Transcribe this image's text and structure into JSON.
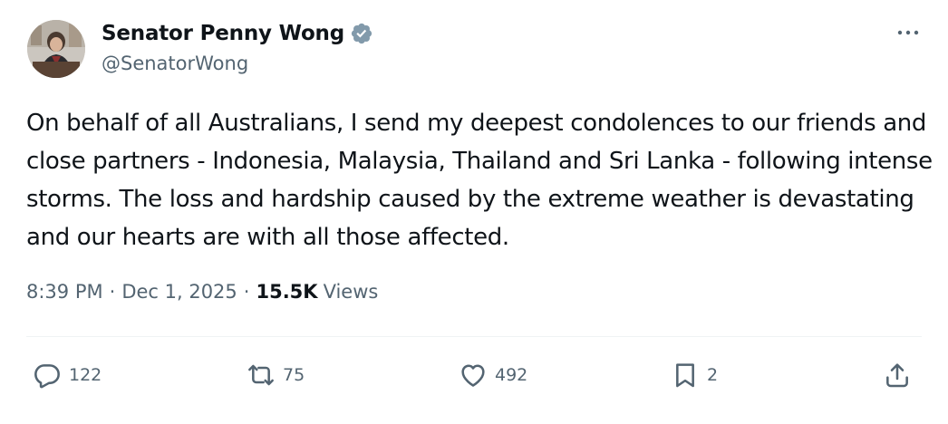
{
  "author": {
    "display_name": "Senator Penny Wong",
    "handle": "@SenatorWong",
    "verified": true
  },
  "tweet": {
    "text": "On behalf of all Australians, I send my deepest condolences to our friends and close partners - Indonesia, Malaysia, Thailand and Sri Lanka - following intense storms. The loss and hardship caused by the extreme weather is devastating and our hearts are with all those affected.",
    "time": "8:39 PM",
    "separator": "·",
    "date": "Dec 1, 2025",
    "views_count": "15.5K",
    "views_label": "Views"
  },
  "actions": {
    "replies": "122",
    "reposts": "75",
    "likes": "492",
    "bookmarks": "2"
  },
  "icons": {
    "more": "more-icon",
    "verified": "verified-badge-icon",
    "reply": "reply-icon",
    "repost": "repost-icon",
    "like": "heart-icon",
    "bookmark": "bookmark-icon",
    "share": "share-icon"
  },
  "colors": {
    "text_primary": "#0f1419",
    "text_secondary": "#536471",
    "verified_badge": "#829aab",
    "divider": "#eff3f4"
  }
}
